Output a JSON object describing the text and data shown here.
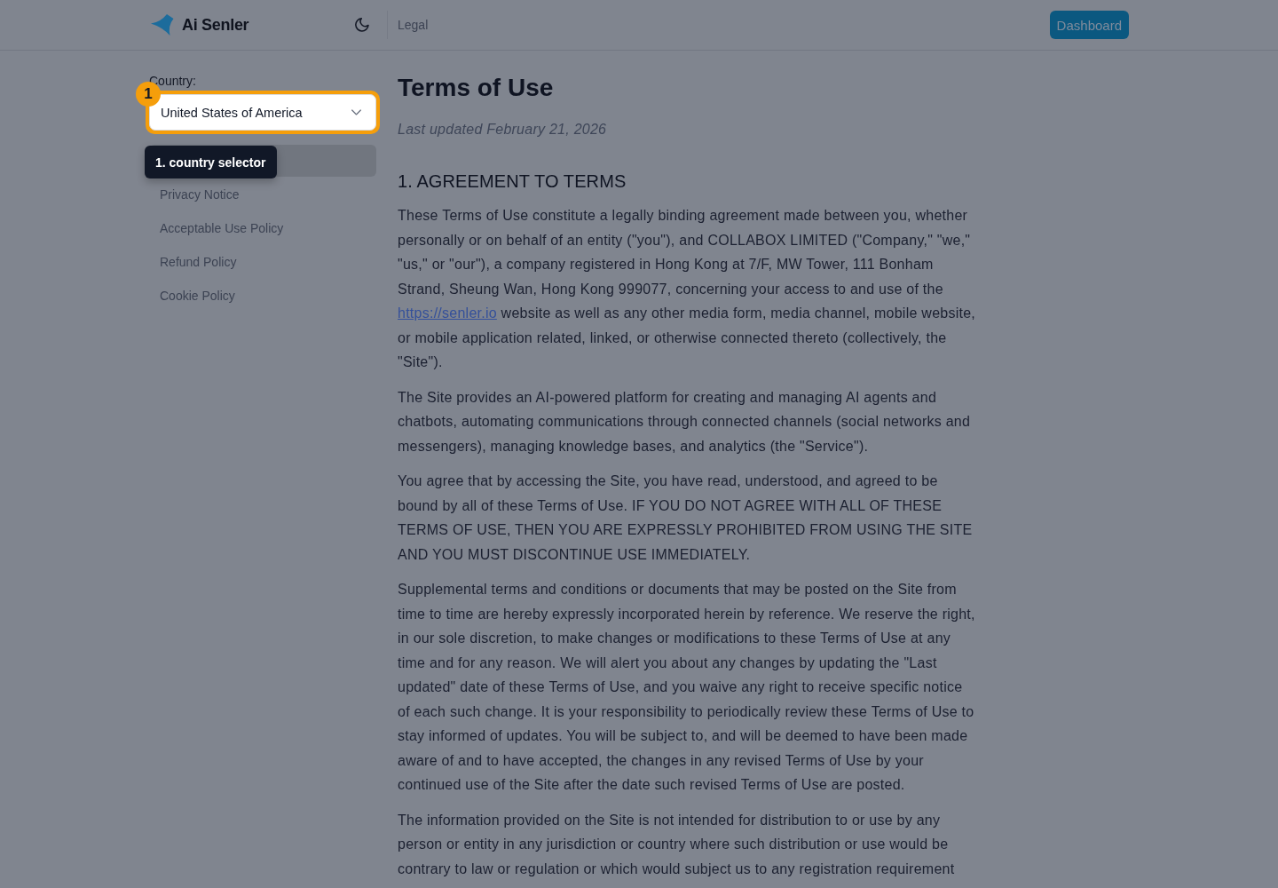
{
  "header": {
    "logo_text": "Ai Senler",
    "breadcrumb": "Legal",
    "dashboard_button": "Dashboard"
  },
  "sidebar": {
    "country_label": "Country:",
    "country_select": {
      "value": "United States of America",
      "highlighted": true
    },
    "items": [
      {
        "selected": true
      },
      {
        "label": "Privacy Notice",
        "selected": false
      },
      {
        "label": "Acceptable Use Policy",
        "selected": false
      },
      {
        "label": "Refund Policy",
        "selected": false
      },
      {
        "label": "Cookie Policy",
        "selected": false
      }
    ]
  },
  "tour": {
    "step_badge": "1",
    "tooltip": "1. country selector"
  },
  "article": {
    "title": "Terms of Use",
    "updated": "Last updated February 21, 2026",
    "sections": [
      {
        "heading": "1. AGREEMENT TO TERMS",
        "paragraphs": [
          {
            "parts": [
              {
                "kind": "text",
                "text": "These Terms of Use constitute a legally binding agreement made between you, whether personally or on behalf of an entity (\"you\"), and COLLABOX LIMITED (\"Company,\" \"we,\" \"us,\" or \"our\"), a company registered in Hong Kong at 7/F, MW Tower, 111 Bonham Strand, Sheung Wan, Hong Kong 999077, concerning your access to and use of the "
              },
              {
                "kind": "link",
                "text": "https://senler.io"
              },
              {
                "kind": "text",
                "text": " website as well as any other media form, media channel, mobile website, or mobile application related, linked, or otherwise connected thereto (collectively, the \"Site\")."
              }
            ]
          },
          {
            "parts": [
              {
                "kind": "text",
                "text": "The Site provides an AI-powered platform for creating and managing AI agents and chatbots, automating communications through connected channels (social networks and messengers), managing knowledge bases, and analytics (the \"Service\")."
              }
            ]
          },
          {
            "parts": [
              {
                "kind": "text",
                "text": "You agree that by accessing the Site, you have read, understood, and agreed to be bound by all of these Terms of Use. IF YOU DO NOT AGREE WITH ALL OF THESE TERMS OF USE, THEN YOU ARE EXPRESSLY PROHIBITED FROM USING THE SITE AND YOU MUST DISCONTINUE USE IMMEDIATELY."
              }
            ]
          },
          {
            "parts": [
              {
                "kind": "text",
                "text": "Supplemental terms and conditions or documents that may be posted on the Site from time to time are hereby expressly incorporated herein by reference. We reserve the right, in our sole discretion, to make changes or modifications to these Terms of Use at any time and for any reason. We will alert you about any changes by updating the \"Last updated\" date of these Terms of Use, and you waive any right to receive specific notice of each such change. It is your responsibility to periodically review these Terms of Use to stay informed of updates. You will be subject to, and will be deemed to have been made aware of and to have accepted, the changes in any revised Terms of Use by your continued use of the Site after the date such revised Terms of Use are posted."
              }
            ]
          },
          {
            "parts": [
              {
                "kind": "text",
                "text": "The information provided on the Site is not intended for distribution to or use by any person or entity in any jurisdiction or country where such distribution or use would be contrary to law or regulation or which would subject us to any registration requirement"
              }
            ]
          }
        ]
      }
    ]
  }
}
